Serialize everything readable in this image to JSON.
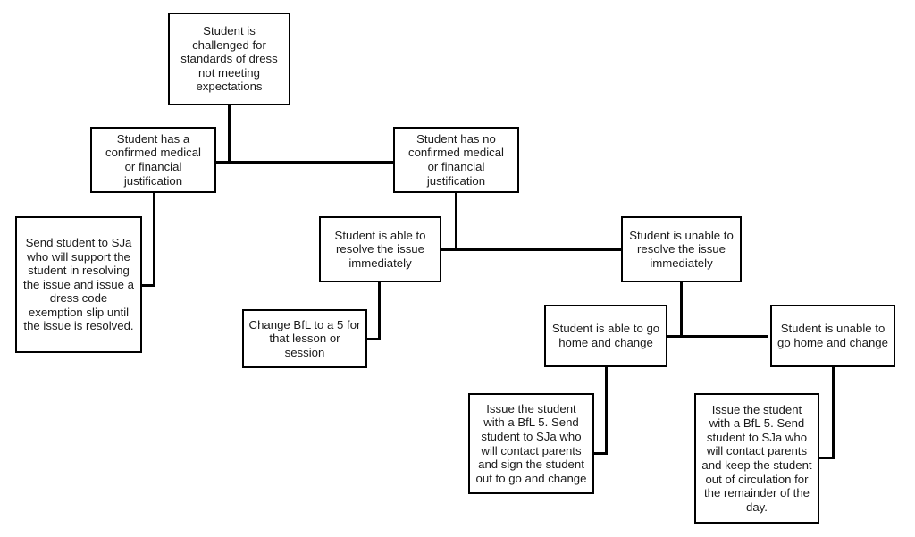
{
  "diagram": {
    "title": "Student dress code challenge flowchart",
    "background_color": "#ffffff",
    "line_color": "#000000",
    "box_fill": "#ffffff",
    "text_color": "#1a1a1a"
  },
  "nodes": {
    "root": "Student is\nchallenged for\nstandards of dress\nnot meeting\nexpectations",
    "medical_yes": "Student has a\nconfirmed medical\nor financial\njustification",
    "medical_no": "Student has no\nconfirmed medical\nor financial\njustification",
    "send_sja_exemption": "Send student to SJa\nwho will support the\nstudent in resolving\nthe issue and issue a\ndress code\nexemption slip until\nthe issue is resolved.",
    "resolve_able": "Student is able to\nresolve the issue\nimmediately",
    "resolve_unable": "Student is unable to\nresolve the issue\nimmediately",
    "change_bfl": "Change BfL to a 5 for\nthat lesson or\nsession",
    "home_able": "Student is able to go\nhome and change",
    "home_unable": "Student is unable to\ngo home and change",
    "bfl_sign_out": "Issue the student\nwith a BfL 5.  Send\nstudent to SJa who\nwill contact parents\nand sign the student\nout to go and change",
    "bfl_keep_out": "Issue the student\nwith a BfL 5. Send\nstudent to SJa who\nwill contact parents\nand keep the student\nout of circulation for\nthe remainder of the\nday."
  }
}
